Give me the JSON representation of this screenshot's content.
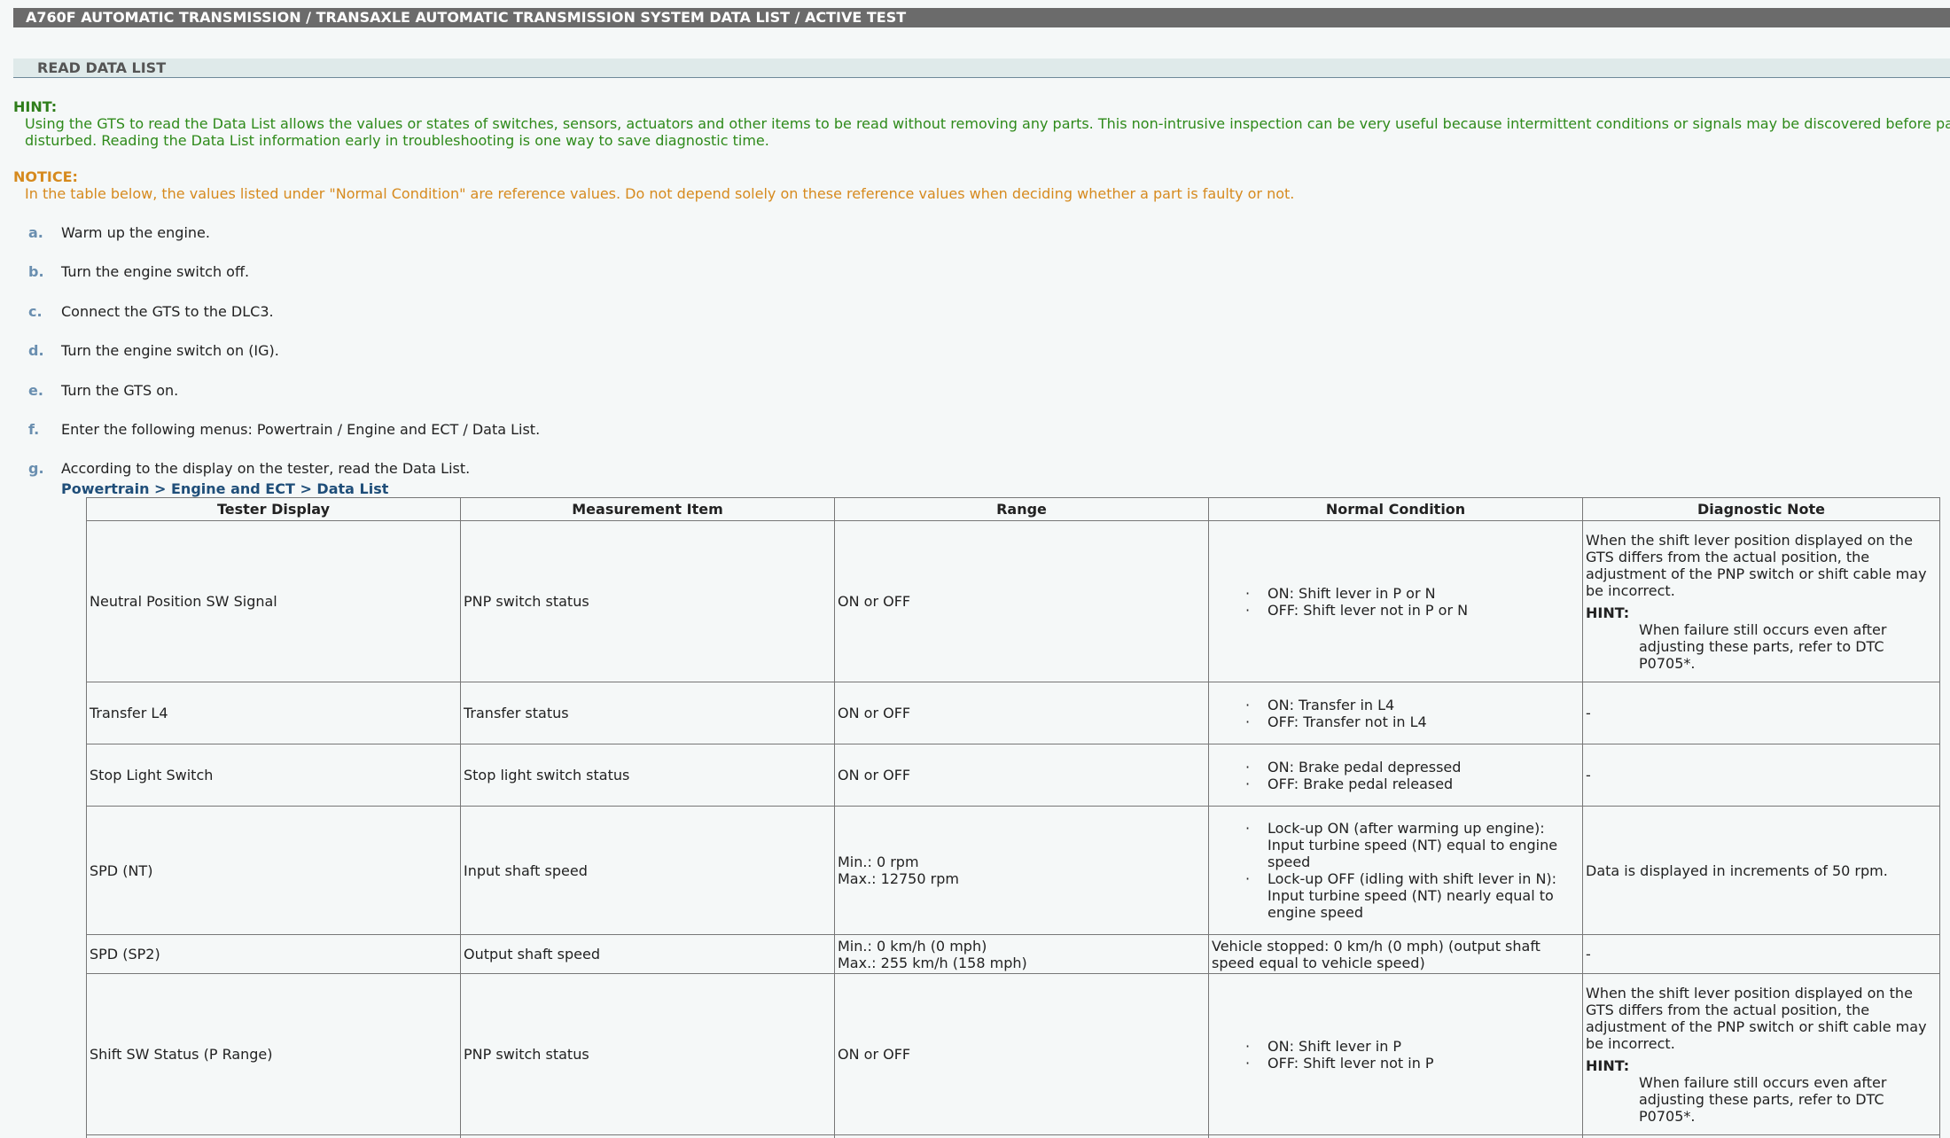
{
  "header": {
    "title": "A760F AUTOMATIC TRANSMISSION / TRANSAXLE  AUTOMATIC TRANSMISSION SYSTEM  DATA LIST / ACTIVE TEST"
  },
  "section": {
    "title": "READ DATA LIST"
  },
  "hint": {
    "label": "HINT:",
    "line1": "Using the GTS to read the Data List allows the values or states of switches, sensors, actuators and other items to be read without removing any parts. This non-intrusive inspection can be very useful because intermittent conditions or signals may be discovered before parts or wiring is",
    "line2": "disturbed. Reading the Data List information early in troubleshooting is one way to save diagnostic time."
  },
  "notice": {
    "label": "NOTICE:",
    "text": "In the table below, the values listed under \"Normal Condition\" are reference values. Do not depend solely on these reference values when deciding whether a part is faulty or not."
  },
  "steps": [
    {
      "letter": "a.",
      "text": "Warm up the engine."
    },
    {
      "letter": "b.",
      "text": "Turn the engine switch off."
    },
    {
      "letter": "c.",
      "text": "Connect the GTS to the DLC3."
    },
    {
      "letter": "d.",
      "text": "Turn the engine switch on (IG)."
    },
    {
      "letter": "e.",
      "text": "Turn the GTS on."
    },
    {
      "letter": "f.",
      "text": "Enter the following menus: Powertrain / Engine and ECT / Data List."
    },
    {
      "letter": "g.",
      "text": "According to the display on the tester, read the Data List."
    }
  ],
  "breadcrumb": "Powertrain > Engine and ECT > Data List",
  "table": {
    "headers": [
      "Tester Display",
      "Measurement Item",
      "Range",
      "Normal Condition",
      "Diagnostic Note"
    ],
    "rows": [
      {
        "display": "Neutral Position SW Signal",
        "item": "PNP switch status",
        "range1": "ON or OFF",
        "range2": "",
        "cond1": "ON: Shift lever in P or N",
        "cond2": "OFF: Shift lever not in P or N",
        "note": "When the shift lever position displayed on the GTS differs from the actual position, the adjustment of the PNP switch or shift cable may be incorrect.",
        "note_hint_label": "HINT:",
        "note_hint": "When failure still occurs even after adjusting these parts, refer to DTC P0705*."
      },
      {
        "display": "Transfer L4",
        "item": "Transfer status",
        "range1": "ON or OFF",
        "cond1": "ON: Transfer in L4",
        "cond2": "OFF: Transfer not in L4",
        "note": "-"
      },
      {
        "display": "Stop Light Switch",
        "item": "Stop light switch status",
        "range1": "ON or OFF",
        "cond1": "ON: Brake pedal depressed",
        "cond2": "OFF: Brake pedal released",
        "note": "-"
      },
      {
        "display": "SPD (NT)",
        "item": "Input shaft speed",
        "range1": "Min.: 0 rpm",
        "range2": "Max.: 12750 rpm",
        "cond1": "Lock-up ON (after warming up engine): Input turbine speed (NT) equal to engine speed",
        "cond2": "Lock-up OFF (idling with shift lever in N): Input turbine speed (NT) nearly equal to engine speed",
        "note": "Data is displayed in increments of 50 rpm."
      },
      {
        "display": "SPD (SP2)",
        "item": "Output shaft speed",
        "range1": "Min.: 0 km/h (0 mph)",
        "range2": "Max.: 255 km/h (158 mph)",
        "cond_plain": "Vehicle stopped: 0 km/h (0 mph) (output shaft speed equal to vehicle speed)",
        "note": "-"
      },
      {
        "display": "Shift SW Status (P Range)",
        "item": "PNP switch status",
        "range1": "ON or OFF",
        "cond1": "ON: Shift lever in P",
        "cond2": "OFF: Shift lever not in P",
        "note": "When the shift lever position displayed on the GTS differs from the actual position, the adjustment of the PNP switch or shift cable may be incorrect.",
        "note_hint_label": "HINT:",
        "note_hint": "When failure still occurs even after adjusting these parts, refer to DTC P0705*."
      }
    ]
  }
}
